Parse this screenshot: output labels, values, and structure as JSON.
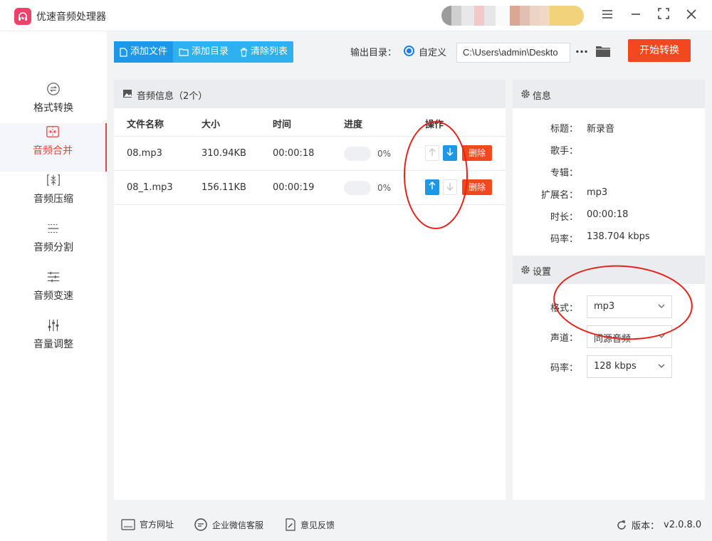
{
  "app": {
    "title": "优速音频处理器"
  },
  "window": {
    "menu_icon": "hamburger-icon",
    "minimize_icon": "minimize-icon",
    "maximize_icon": "fullscreen-icon",
    "close_icon": "close-icon"
  },
  "sidebar": {
    "items": [
      {
        "label": "格式转换",
        "icon": "convert-icon",
        "active": false
      },
      {
        "label": "音频合并",
        "icon": "merge-icon",
        "active": true
      },
      {
        "label": "音频压缩",
        "icon": "compress-icon",
        "active": false
      },
      {
        "label": "音频分割",
        "icon": "split-icon",
        "active": false
      },
      {
        "label": "音频变速",
        "icon": "speed-icon",
        "active": false
      },
      {
        "label": "音量调整",
        "icon": "volume-icon",
        "active": false
      }
    ]
  },
  "toolbar": {
    "add_file": "添加文件",
    "add_dir": "添加目录",
    "clear_list": "清除列表",
    "output_label": "输出目录：",
    "custom_label": "自定义",
    "path": "C:\\Users\\admin\\Deskto",
    "more": "···",
    "start": "开始转换"
  },
  "file_list": {
    "title": "音频信息（2个）",
    "columns": {
      "name": "文件名称",
      "size": "大小",
      "time": "时间",
      "progress": "进度",
      "ops": "操作"
    },
    "rows": [
      {
        "name": "08.mp3",
        "size": "310.94KB",
        "time": "00:00:18",
        "progress": 0,
        "progress_text": "0%",
        "delete": "删除"
      },
      {
        "name": "08_1.mp3",
        "size": "156.11KB",
        "time": "00:00:19",
        "progress": 0,
        "progress_text": "0%",
        "delete": "删除"
      }
    ]
  },
  "info": {
    "title": "信息",
    "fields": [
      {
        "key": "标题：",
        "value": "新录音"
      },
      {
        "key": "歌手：",
        "value": ""
      },
      {
        "key": "专辑：",
        "value": ""
      },
      {
        "key": "扩展名：",
        "value": "mp3"
      },
      {
        "key": "时长：",
        "value": "00:00:18"
      },
      {
        "key": "码率：",
        "value": "138.704 kbps"
      }
    ]
  },
  "settings": {
    "title": "设置",
    "fields": [
      {
        "key": "格式：",
        "value": "mp3"
      },
      {
        "key": "声道：",
        "value": "同源音频"
      },
      {
        "key": "码率：",
        "value": "128 kbps"
      }
    ]
  },
  "footer": {
    "website": "官方网址",
    "wechat": "企业微信客服",
    "feedback": "意见反馈",
    "version_label": "版本：",
    "version": "v2.0.8.0"
  },
  "colors": {
    "accent": "#f2471f",
    "primary": "#1e97e6",
    "active_nav": "#e8423c"
  }
}
